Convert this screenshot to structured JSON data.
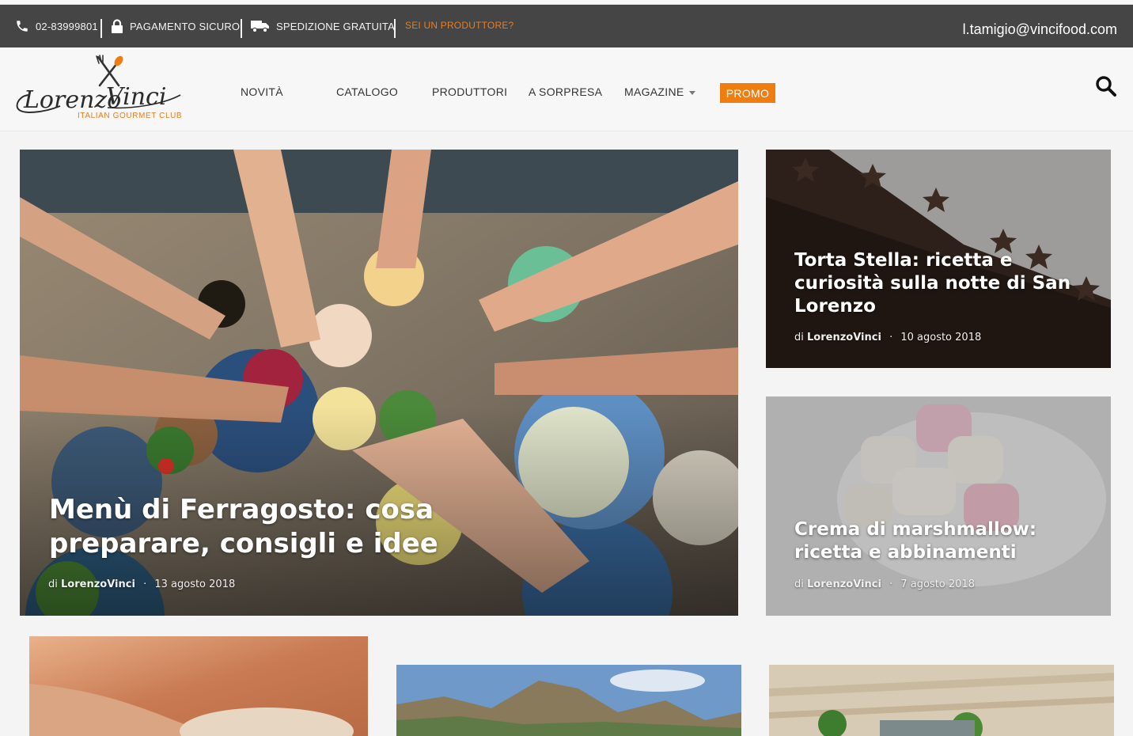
{
  "utility_bar": {
    "phone": "02-83999801",
    "secure_payment": "PAGAMENTO SICURO",
    "free_shipping": "SPEDIZIONE GRATUITA",
    "producer_cta": "SEI UN PRODUTTORE?",
    "email": "l.tamigio@vincifood.com"
  },
  "logo": {
    "name": "LorenzoVinci",
    "tagline": "ITALIAN GOURMET CLUB"
  },
  "nav": {
    "items": [
      "NOVITÀ",
      "CATALOGO",
      "PRODUTTORI",
      "A SORPRESA",
      "MAGAZINE"
    ],
    "promo": "PROMO"
  },
  "articles": [
    {
      "title_line1": "Menù di Ferragosto: cosa",
      "title_line2": "preparare, consigli e idee",
      "by": "di",
      "author": "LorenzoVinci",
      "sep": "·",
      "date": "13 agosto 2018"
    },
    {
      "title_line1": "Torta Stella: ricetta e",
      "title_line2": "curiosità sulla notte di San",
      "title_line3": "Lorenzo",
      "by": "di",
      "author": "LorenzoVinci",
      "sep": "·",
      "date": "10 agosto 2018"
    },
    {
      "title_line1": "Crema di marshmallow:",
      "title_line2": "ricetta e abbinamenti",
      "by": "di",
      "author": "LorenzoVinci",
      "sep": "·",
      "date": "7 agosto 2018"
    }
  ],
  "colors": {
    "accent": "#f07d10",
    "utility_bg": "#454545"
  }
}
